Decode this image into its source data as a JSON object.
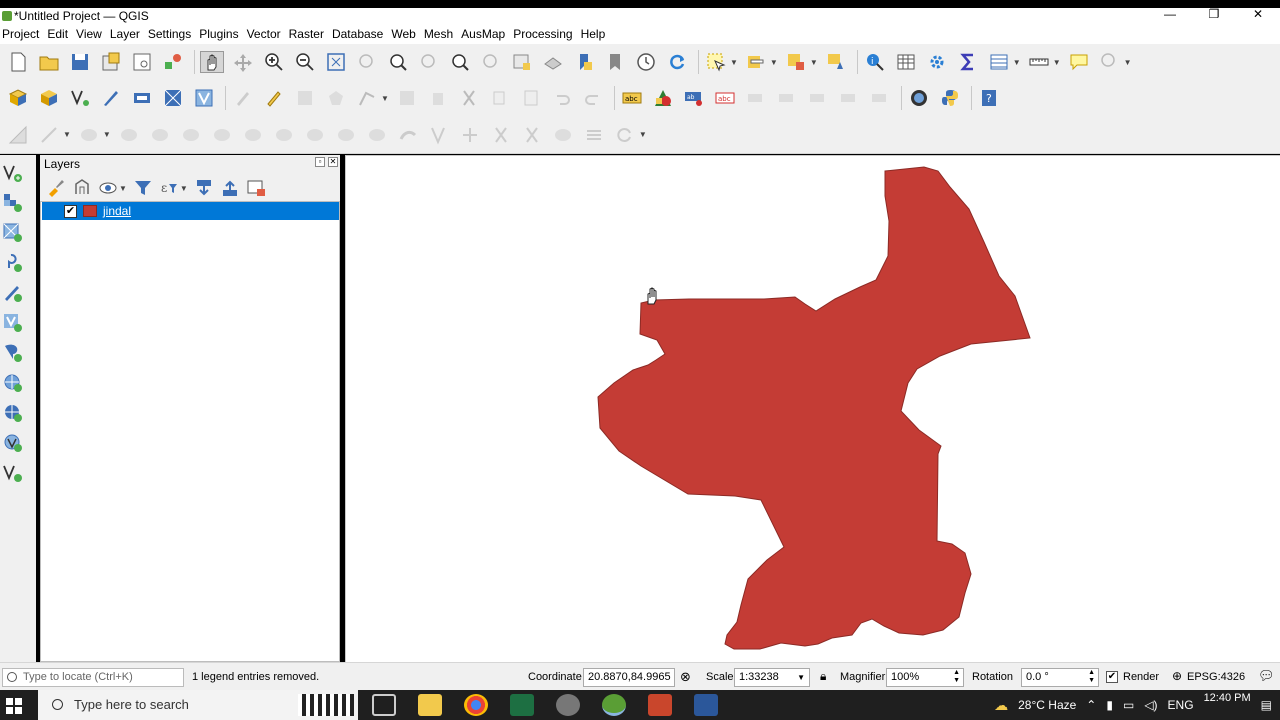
{
  "window": {
    "title": "*Untitled Project — QGIS",
    "min": "—",
    "max": "❐",
    "close": "✕"
  },
  "menu": [
    "Project",
    "Edit",
    "View",
    "Layer",
    "Settings",
    "Plugins",
    "Vector",
    "Raster",
    "Database",
    "Web",
    "Mesh",
    "AusMap",
    "Processing",
    "Help"
  ],
  "layers_panel": {
    "title": "Layers",
    "layers": [
      {
        "name": "jindal",
        "checked": true,
        "selected": true,
        "color": "#c43c35"
      }
    ]
  },
  "statusbar": {
    "locate_placeholder": "Type to locate (Ctrl+K)",
    "message": "1 legend entries removed.",
    "coordinate_label": "Coordinate",
    "coordinate_value": "20.8870,84.9965",
    "scale_label": "Scale",
    "scale_value": "1:33238",
    "magnifier_label": "Magnifier",
    "magnifier_value": "100%",
    "rotation_label": "Rotation",
    "rotation_value": "0.0 °",
    "render_label": "Render",
    "crs": "EPSG:4326"
  },
  "taskbar": {
    "search_placeholder": "Type here to search",
    "weather": "28°C Haze",
    "language": "ENG",
    "time": "12:40 PM"
  },
  "colors": {
    "polygon_fill": "#c43c35",
    "polygon_stroke": "#8c2a25",
    "selection": "#0078d7"
  }
}
